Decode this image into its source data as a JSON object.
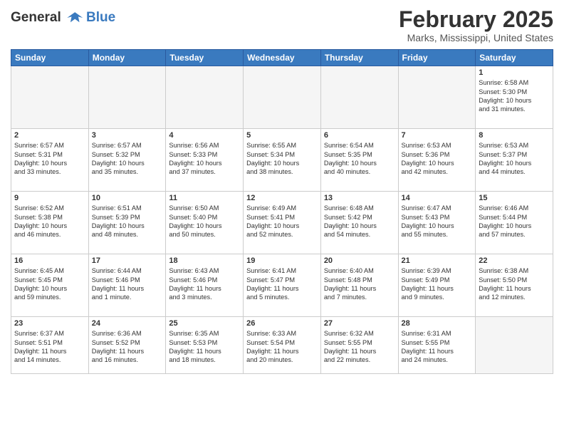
{
  "header": {
    "logo_line1": "General",
    "logo_line2": "Blue",
    "month": "February 2025",
    "location": "Marks, Mississippi, United States"
  },
  "days_of_week": [
    "Sunday",
    "Monday",
    "Tuesday",
    "Wednesday",
    "Thursday",
    "Friday",
    "Saturday"
  ],
  "weeks": [
    [
      {
        "day": "",
        "info": ""
      },
      {
        "day": "",
        "info": ""
      },
      {
        "day": "",
        "info": ""
      },
      {
        "day": "",
        "info": ""
      },
      {
        "day": "",
        "info": ""
      },
      {
        "day": "",
        "info": ""
      },
      {
        "day": "1",
        "info": "Sunrise: 6:58 AM\nSunset: 5:30 PM\nDaylight: 10 hours\nand 31 minutes."
      }
    ],
    [
      {
        "day": "2",
        "info": "Sunrise: 6:57 AM\nSunset: 5:31 PM\nDaylight: 10 hours\nand 33 minutes."
      },
      {
        "day": "3",
        "info": "Sunrise: 6:57 AM\nSunset: 5:32 PM\nDaylight: 10 hours\nand 35 minutes."
      },
      {
        "day": "4",
        "info": "Sunrise: 6:56 AM\nSunset: 5:33 PM\nDaylight: 10 hours\nand 37 minutes."
      },
      {
        "day": "5",
        "info": "Sunrise: 6:55 AM\nSunset: 5:34 PM\nDaylight: 10 hours\nand 38 minutes."
      },
      {
        "day": "6",
        "info": "Sunrise: 6:54 AM\nSunset: 5:35 PM\nDaylight: 10 hours\nand 40 minutes."
      },
      {
        "day": "7",
        "info": "Sunrise: 6:53 AM\nSunset: 5:36 PM\nDaylight: 10 hours\nand 42 minutes."
      },
      {
        "day": "8",
        "info": "Sunrise: 6:53 AM\nSunset: 5:37 PM\nDaylight: 10 hours\nand 44 minutes."
      }
    ],
    [
      {
        "day": "9",
        "info": "Sunrise: 6:52 AM\nSunset: 5:38 PM\nDaylight: 10 hours\nand 46 minutes."
      },
      {
        "day": "10",
        "info": "Sunrise: 6:51 AM\nSunset: 5:39 PM\nDaylight: 10 hours\nand 48 minutes."
      },
      {
        "day": "11",
        "info": "Sunrise: 6:50 AM\nSunset: 5:40 PM\nDaylight: 10 hours\nand 50 minutes."
      },
      {
        "day": "12",
        "info": "Sunrise: 6:49 AM\nSunset: 5:41 PM\nDaylight: 10 hours\nand 52 minutes."
      },
      {
        "day": "13",
        "info": "Sunrise: 6:48 AM\nSunset: 5:42 PM\nDaylight: 10 hours\nand 54 minutes."
      },
      {
        "day": "14",
        "info": "Sunrise: 6:47 AM\nSunset: 5:43 PM\nDaylight: 10 hours\nand 55 minutes."
      },
      {
        "day": "15",
        "info": "Sunrise: 6:46 AM\nSunset: 5:44 PM\nDaylight: 10 hours\nand 57 minutes."
      }
    ],
    [
      {
        "day": "16",
        "info": "Sunrise: 6:45 AM\nSunset: 5:45 PM\nDaylight: 10 hours\nand 59 minutes."
      },
      {
        "day": "17",
        "info": "Sunrise: 6:44 AM\nSunset: 5:46 PM\nDaylight: 11 hours\nand 1 minute."
      },
      {
        "day": "18",
        "info": "Sunrise: 6:43 AM\nSunset: 5:46 PM\nDaylight: 11 hours\nand 3 minutes."
      },
      {
        "day": "19",
        "info": "Sunrise: 6:41 AM\nSunset: 5:47 PM\nDaylight: 11 hours\nand 5 minutes."
      },
      {
        "day": "20",
        "info": "Sunrise: 6:40 AM\nSunset: 5:48 PM\nDaylight: 11 hours\nand 7 minutes."
      },
      {
        "day": "21",
        "info": "Sunrise: 6:39 AM\nSunset: 5:49 PM\nDaylight: 11 hours\nand 9 minutes."
      },
      {
        "day": "22",
        "info": "Sunrise: 6:38 AM\nSunset: 5:50 PM\nDaylight: 11 hours\nand 12 minutes."
      }
    ],
    [
      {
        "day": "23",
        "info": "Sunrise: 6:37 AM\nSunset: 5:51 PM\nDaylight: 11 hours\nand 14 minutes."
      },
      {
        "day": "24",
        "info": "Sunrise: 6:36 AM\nSunset: 5:52 PM\nDaylight: 11 hours\nand 16 minutes."
      },
      {
        "day": "25",
        "info": "Sunrise: 6:35 AM\nSunset: 5:53 PM\nDaylight: 11 hours\nand 18 minutes."
      },
      {
        "day": "26",
        "info": "Sunrise: 6:33 AM\nSunset: 5:54 PM\nDaylight: 11 hours\nand 20 minutes."
      },
      {
        "day": "27",
        "info": "Sunrise: 6:32 AM\nSunset: 5:55 PM\nDaylight: 11 hours\nand 22 minutes."
      },
      {
        "day": "28",
        "info": "Sunrise: 6:31 AM\nSunset: 5:55 PM\nDaylight: 11 hours\nand 24 minutes."
      },
      {
        "day": "",
        "info": ""
      }
    ]
  ]
}
